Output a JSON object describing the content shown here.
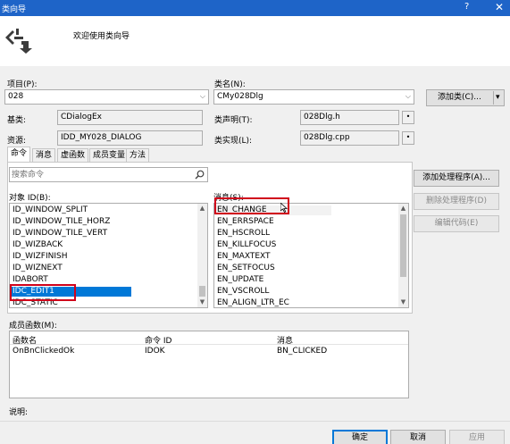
{
  "window": {
    "title": "类向导",
    "help": "?",
    "close": "✕"
  },
  "header": {
    "welcome": "欢迎使用类向导"
  },
  "project": {
    "label": "项目(P):",
    "value": "028"
  },
  "classname": {
    "label": "类名(N):",
    "value": "CMy028Dlg"
  },
  "add_class_button": "添加类(C)...",
  "split_arrow": "▾",
  "base_class": {
    "label": "基类:",
    "value": "CDialogEx"
  },
  "class_decl": {
    "label": "类声明(T):",
    "value": "028Dlg.h"
  },
  "resource": {
    "label": "资源:",
    "value": "IDD_MY028_DIALOG"
  },
  "class_impl": {
    "label": "类实现(L):",
    "value": "028Dlg.cpp"
  },
  "dots": "•",
  "tabs": [
    "命令",
    "消息",
    "虚函数",
    "成员变量",
    "方法"
  ],
  "search": {
    "placeholder": "搜索命令"
  },
  "object_ids": {
    "label": "对象 ID(B):",
    "items": [
      "ID_WINDOW_SPLIT",
      "ID_WINDOW_TILE_HORZ",
      "ID_WINDOW_TILE_VERT",
      "ID_WIZBACK",
      "ID_WIZFINISH",
      "ID_WIZNEXT",
      "IDABORT",
      "IDC_EDIT1",
      "IDC_STATIC"
    ]
  },
  "messages": {
    "label": "消息(S):",
    "items": [
      "EN_CHANGE",
      "EN_ERRSPACE",
      "EN_HSCROLL",
      "EN_KILLFOCUS",
      "EN_MAXTEXT",
      "EN_SETFOCUS",
      "EN_UPDATE",
      "EN_VSCROLL",
      "EN_ALIGN_LTR_EC"
    ]
  },
  "right_buttons": {
    "add_handler": "添加处理程序(A)...",
    "delete_handler": "删除处理程序(D)",
    "edit_code": "编辑代码(E)"
  },
  "members": {
    "label": "成员函数(M):",
    "columns": [
      "函数名",
      "命令 ID",
      "消息"
    ],
    "rows": [
      [
        "OnBnClickedOk",
        "IDOK",
        "BN_CLICKED"
      ]
    ]
  },
  "description": {
    "label": "说明:"
  },
  "footer": {
    "ok": "确定",
    "cancel": "取消",
    "apply": "应用"
  },
  "colors": {
    "titlebar": "#1e64c8",
    "selection": "#0078d7",
    "highlight_box": "#d0021b"
  }
}
